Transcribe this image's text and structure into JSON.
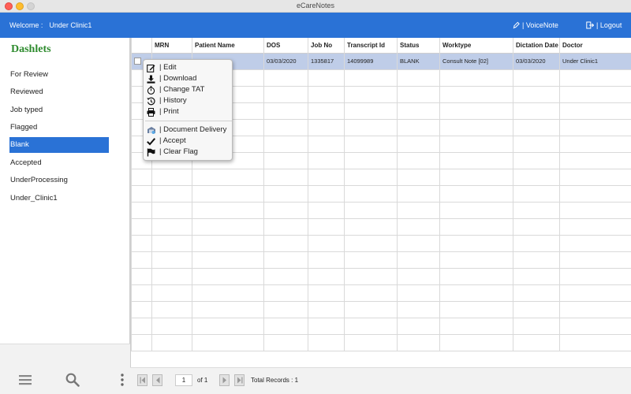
{
  "window": {
    "title": "eCareNotes"
  },
  "header": {
    "welcome_label": "Welcome :",
    "user_name": "Under Clinic1",
    "voicenote_label": "| VoiceNote",
    "logout_label": "| Logout"
  },
  "sidebar": {
    "title": "Dashlets",
    "items": [
      {
        "label": "For Review"
      },
      {
        "label": "Reviewed"
      },
      {
        "label": "Job typed"
      },
      {
        "label": "Flagged"
      },
      {
        "label": "Blank"
      },
      {
        "label": "Accepted"
      },
      {
        "label": "UnderProcessing"
      },
      {
        "label": "Under_Clinic1"
      }
    ],
    "active_index": 4
  },
  "table": {
    "columns": [
      "MRN",
      "Patient Name",
      "DOS",
      "Job No",
      "Transcript Id",
      "Status",
      "Worktype",
      "Dictation Date",
      "Doctor"
    ],
    "rows": [
      {
        "mrn": "",
        "patient_name": "",
        "dos": "03/03/2020",
        "job_no": "1335817",
        "transcript_id": "14099989",
        "status": "BLANK",
        "worktype": "Consult Note [02]",
        "dictation_date": "03/03/2020",
        "doctor": "Under Clinic1"
      }
    ]
  },
  "context_menu": {
    "items": [
      {
        "label": "| Edit",
        "icon": "edit-icon"
      },
      {
        "label": "| Download",
        "icon": "download-icon"
      },
      {
        "label": "| Change TAT",
        "icon": "stopwatch-icon"
      },
      {
        "label": "| History",
        "icon": "history-icon"
      },
      {
        "label": "| Print",
        "icon": "print-icon"
      },
      {
        "label": "| Document Delivery",
        "icon": "delivery-icon"
      },
      {
        "label": "| Accept",
        "icon": "checkmark-icon"
      },
      {
        "label": "| Clear Flag",
        "icon": "flag-icon"
      }
    ]
  },
  "pager": {
    "current_page": "1",
    "of_label": "of 1",
    "total_label": "Total Records : 1"
  },
  "colors": {
    "header_blue": "#2a72d6",
    "selected_row": "#bfcde8",
    "dashlets_green": "#2e8b2e"
  }
}
